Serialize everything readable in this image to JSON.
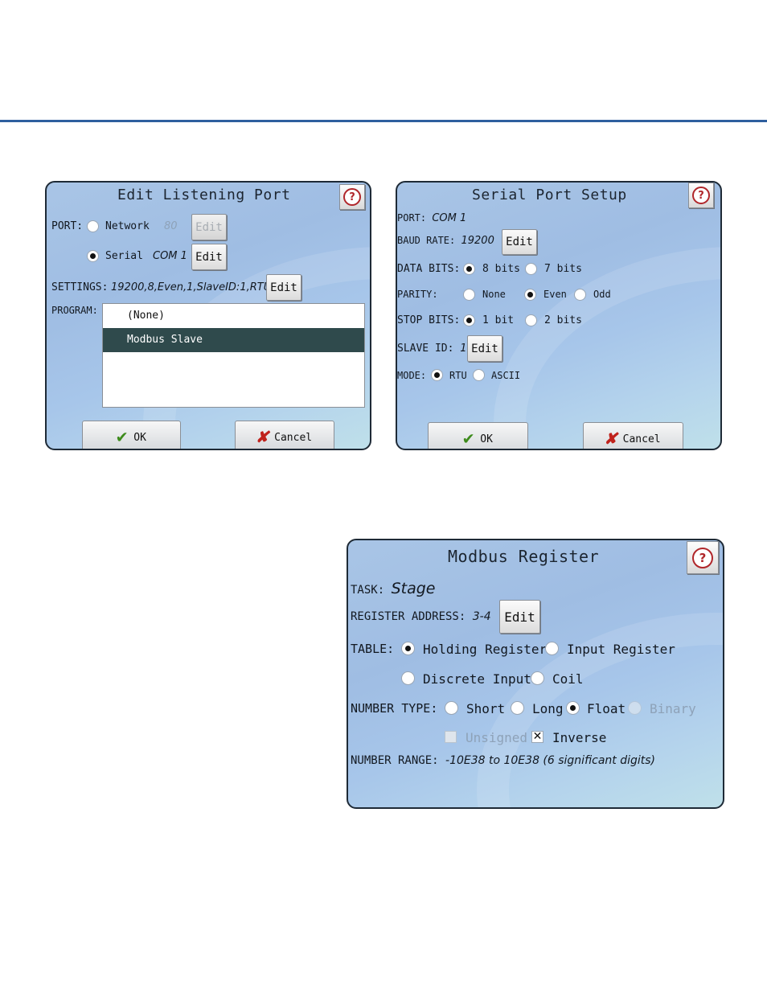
{
  "colors": {
    "rule": "#2e5f9e",
    "selected_row": "#2f4a4c",
    "ok_icon": "#3d8b1c",
    "cancel_icon": "#c0221c"
  },
  "icons": {
    "help": "help-icon",
    "ok": "checkmark-icon",
    "cancel": "x-icon"
  },
  "edit_port": {
    "title": "Edit Listening Port",
    "port_label": "PORT:",
    "network_label": "Network",
    "network_value": "80",
    "serial_label": "Serial",
    "serial_value": "COM 1",
    "edit_label": "Edit",
    "port_selected": "serial",
    "settings_label": "SETTINGS:",
    "settings_value": "19200,8,Even,1,SlaveID:1,RTU",
    "program_label": "PROGRAM:",
    "program_items": [
      "(None)",
      "Modbus Slave"
    ],
    "program_selected": "Modbus Slave",
    "ok_label": "OK",
    "cancel_label": "Cancel",
    "help_glyph": "?"
  },
  "serial_setup": {
    "title": "Serial Port Setup",
    "port_label": "PORT:",
    "port_value": "COM 1",
    "baud_label": "BAUD RATE:",
    "baud_value": "19200",
    "edit_label": "Edit",
    "data_bits_label": "DATA BITS:",
    "data_bits_options": [
      "8 bits",
      "7 bits"
    ],
    "data_bits_selected": "8 bits",
    "parity_label": "PARITY:",
    "parity_options": [
      "None",
      "Even",
      "Odd"
    ],
    "parity_selected": "Even",
    "stop_bits_label": "STOP BITS:",
    "stop_bits_options": [
      "1 bit",
      "2 bits"
    ],
    "stop_bits_selected": "1 bit",
    "slave_id_label": "SLAVE ID:",
    "slave_id_value": "1",
    "mode_label": "MODE:",
    "mode_options": [
      "RTU",
      "ASCII"
    ],
    "mode_selected": "RTU",
    "ok_label": "OK",
    "cancel_label": "Cancel",
    "help_glyph": "?"
  },
  "modbus_register": {
    "title": "Modbus Register",
    "task_label": "TASK:",
    "task_value": "Stage",
    "address_label": "REGISTER ADDRESS:",
    "address_value": "3-4",
    "edit_label": "Edit",
    "table_label": "TABLE:",
    "table_options": [
      "Holding Register",
      "Input Register",
      "Discrete Input",
      "Coil"
    ],
    "table_selected": "Holding Register",
    "number_type_label": "NUMBER TYPE:",
    "number_type_options": [
      "Short",
      "Long",
      "Float",
      "Binary"
    ],
    "number_type_selected": "Float",
    "number_type_disabled": [
      "Binary"
    ],
    "unsigned_label": "Unsigned",
    "unsigned_checked": false,
    "unsigned_disabled": true,
    "inverse_label": "Inverse",
    "inverse_checked": true,
    "range_label": "NUMBER RANGE:",
    "range_value": "-10E38 to 10E38 (6 significant digits)",
    "help_glyph": "?"
  }
}
